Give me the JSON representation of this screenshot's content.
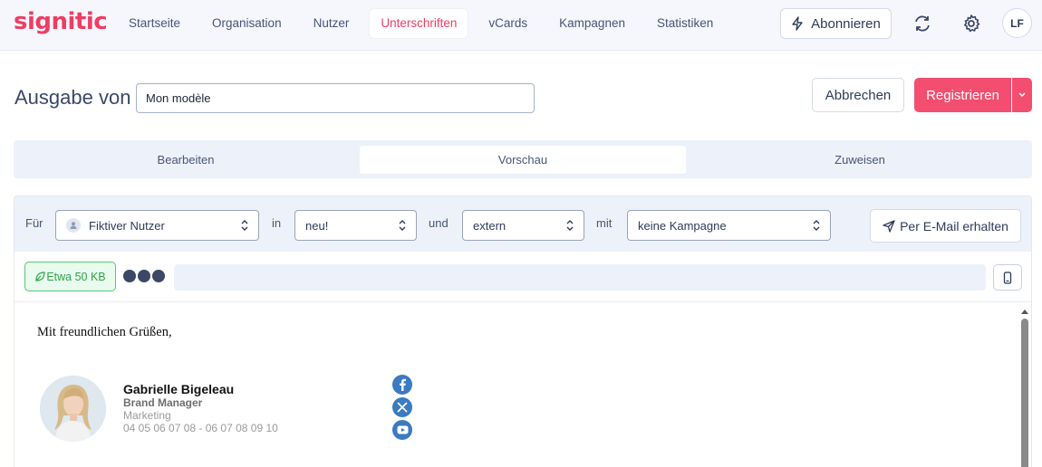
{
  "app": {
    "logo": "signitic"
  },
  "nav": {
    "items": [
      {
        "label": "Startseite",
        "active": false
      },
      {
        "label": "Organisation",
        "active": false
      },
      {
        "label": "Nutzer",
        "active": false
      },
      {
        "label": "Unterschriften",
        "active": true
      },
      {
        "label": "vCards",
        "active": false
      },
      {
        "label": "Kampagnen",
        "active": false
      },
      {
        "label": "Statistiken",
        "active": false
      }
    ],
    "subscribe_label": "Abonnieren",
    "avatar_initials": "LF"
  },
  "header": {
    "title": "Ausgabe von",
    "name_value": "Mon modèle",
    "cancel_label": "Abbrechen",
    "register_label": "Registrieren"
  },
  "tabs": [
    {
      "label": "Bearbeiten",
      "active": false
    },
    {
      "label": "Vorschau",
      "active": true
    },
    {
      "label": "Zuweisen",
      "active": false
    }
  ],
  "filters": {
    "for_label": "Für",
    "user_value": "Fiktiver Nutzer",
    "in_label": "in",
    "status_value": "neu!",
    "and_label": "und",
    "scope_value": "extern",
    "with_label": "mit",
    "campaign_value": "keine Kampagne",
    "email_button_label": "Per E-Mail erhalten"
  },
  "toolbar": {
    "size_label": "Etwa 50 KB"
  },
  "preview": {
    "greeting": "Mit freundlichen Grüßen,",
    "signature": {
      "name": "Gabrielle Bigeleau",
      "role": "Brand Manager",
      "department": "Marketing",
      "phones": "04 05 06 07 08 - 06 07 08 09 10"
    },
    "social": [
      "facebook-icon",
      "x-icon",
      "youtube-icon"
    ]
  },
  "colors": {
    "brand": "#ee3d63",
    "primary_button": "#f34e6f",
    "social": "#3b7bbf",
    "badge_green": "#57c76f"
  }
}
